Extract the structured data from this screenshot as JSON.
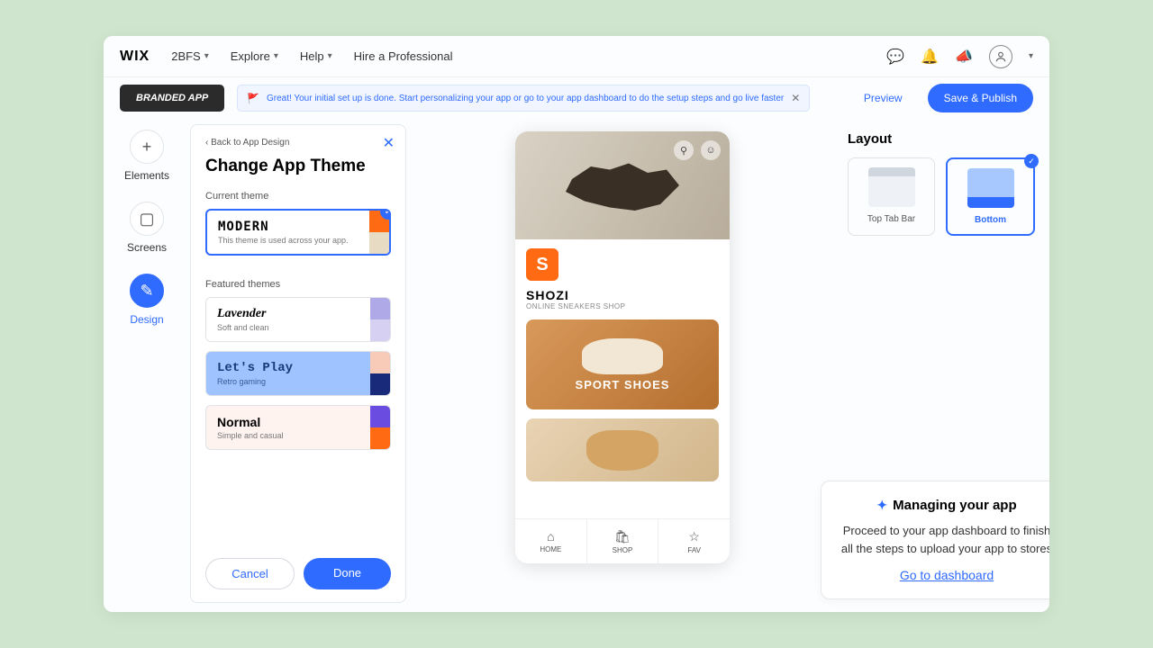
{
  "topbar": {
    "brand": "WIX",
    "site_name": "2BFS",
    "menus": [
      "Explore",
      "Help"
    ],
    "hire": "Hire a Professional"
  },
  "actionbar": {
    "badge": "BRANDED APP",
    "banner": "Great! Your initial set up is done. Start personalizing your app or go to your app dashboard to do the setup steps and go live faster",
    "preview": "Preview",
    "publish": "Save & Publish"
  },
  "rail": {
    "items": [
      {
        "label": "Elements",
        "glyph": "+"
      },
      {
        "label": "Screens",
        "glyph": "▢"
      },
      {
        "label": "Design",
        "glyph": "✎"
      }
    ]
  },
  "panel": {
    "back": "‹  Back to App Design",
    "title": "Change App Theme",
    "current_label": "Current theme",
    "featured_label": "Featured themes",
    "cancel": "Cancel",
    "done": "Done",
    "themes": {
      "current": {
        "name": "MODERN",
        "desc": "This theme is used across your app.",
        "c1": "#ff6a13",
        "c2": "#e8dbc4"
      },
      "featured": [
        {
          "name": "Lavender",
          "desc": "Soft and clean",
          "c1": "#b0a9e8",
          "c2": "#d6d1f2"
        },
        {
          "name": "Let's Play",
          "desc": "Retro gaming",
          "c1": "#f7cbb8",
          "c2": "#1a2a7a"
        },
        {
          "name": "Normal",
          "desc": "Simple and casual",
          "c1": "#6a4de0",
          "c2": "#ff6a13"
        }
      ]
    }
  },
  "phone": {
    "brand": "SHOZI",
    "tagline": "ONLINE SNEAKERS SHOP",
    "card_title": "SPORT SHOES",
    "tabs": [
      {
        "label": "HOME",
        "glyph": "⌂"
      },
      {
        "label": "SHOP",
        "glyph": "🛍"
      },
      {
        "label": "FAV",
        "glyph": "☆"
      }
    ]
  },
  "layout": {
    "title": "Layout",
    "options": [
      {
        "label": "Top Tab Bar"
      },
      {
        "label": "Bottom"
      }
    ]
  },
  "tip": {
    "title": "Managing your app",
    "body": "Proceed to your app dashboard to finish all the steps to upload your app to stores",
    "link": "Go to dashboard"
  }
}
